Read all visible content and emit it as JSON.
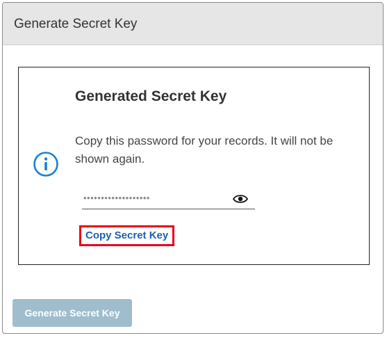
{
  "dialog": {
    "title": "Generate Secret Key"
  },
  "card": {
    "icon": "info-circle-icon",
    "heading": "Generated Secret Key",
    "message": "Copy this password for your records. It will not be shown again.",
    "secret_field": {
      "masked_value": "•••••••••••••••••••",
      "toggle_icon": "eye-icon"
    },
    "copy_label": "Copy Secret Key"
  },
  "footer": {
    "generate_label": "Generate Secret Key",
    "generate_enabled": false
  },
  "colors": {
    "header_bg": "#e6e6e6",
    "info_icon": "#1a7fd4",
    "link": "#1a5fb4",
    "highlight": "#e8001c",
    "disabled_button": "#9fbdcc"
  }
}
